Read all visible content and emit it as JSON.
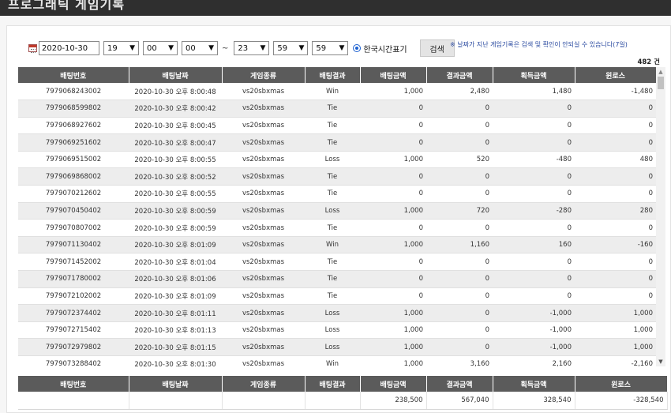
{
  "header": {
    "title": "프로그래틱 게임기록"
  },
  "filter": {
    "date": "2020-10-30",
    "start_hour": "19",
    "start_min": "00",
    "start_sec": "00",
    "separator": "~",
    "end_hour": "23",
    "end_min": "59",
    "end_sec": "59",
    "radio_label": "한국시간표기",
    "search_label": "검색",
    "notice": "※ 날짜가 지난 게임기록은 검색 및 확인이 안되실 수 있습니다(7일)"
  },
  "total_count": "482 건",
  "columns": [
    "배팅번호",
    "배팅날짜",
    "게임종류",
    "배팅결과",
    "배팅금액",
    "결과금액",
    "획득금액",
    "윈로스"
  ],
  "rows": [
    [
      "7979068243002",
      "2020-10-30 오후 8:00:48",
      "vs20sbxmas",
      "Win",
      "1,000",
      "2,480",
      "1,480",
      "-1,480"
    ],
    [
      "7979068599802",
      "2020-10-30 오후 8:00:42",
      "vs20sbxmas",
      "Tie",
      "0",
      "0",
      "0",
      "0"
    ],
    [
      "7979068927602",
      "2020-10-30 오후 8:00:45",
      "vs20sbxmas",
      "Tie",
      "0",
      "0",
      "0",
      "0"
    ],
    [
      "7979069251602",
      "2020-10-30 오후 8:00:47",
      "vs20sbxmas",
      "Tie",
      "0",
      "0",
      "0",
      "0"
    ],
    [
      "7979069515002",
      "2020-10-30 오후 8:00:55",
      "vs20sbxmas",
      "Loss",
      "1,000",
      "520",
      "-480",
      "480"
    ],
    [
      "7979069868002",
      "2020-10-30 오후 8:00:52",
      "vs20sbxmas",
      "Tie",
      "0",
      "0",
      "0",
      "0"
    ],
    [
      "7979070212602",
      "2020-10-30 오후 8:00:55",
      "vs20sbxmas",
      "Tie",
      "0",
      "0",
      "0",
      "0"
    ],
    [
      "7979070450402",
      "2020-10-30 오후 8:00:59",
      "vs20sbxmas",
      "Loss",
      "1,000",
      "720",
      "-280",
      "280"
    ],
    [
      "7979070807002",
      "2020-10-30 오후 8:00:59",
      "vs20sbxmas",
      "Tie",
      "0",
      "0",
      "0",
      "0"
    ],
    [
      "7979071130402",
      "2020-10-30 오후 8:01:09",
      "vs20sbxmas",
      "Win",
      "1,000",
      "1,160",
      "160",
      "-160"
    ],
    [
      "7979071452002",
      "2020-10-30 오후 8:01:04",
      "vs20sbxmas",
      "Tie",
      "0",
      "0",
      "0",
      "0"
    ],
    [
      "7979071780002",
      "2020-10-30 오후 8:01:06",
      "vs20sbxmas",
      "Tie",
      "0",
      "0",
      "0",
      "0"
    ],
    [
      "7979072102002",
      "2020-10-30 오후 8:01:09",
      "vs20sbxmas",
      "Tie",
      "0",
      "0",
      "0",
      "0"
    ],
    [
      "7979072374402",
      "2020-10-30 오후 8:01:11",
      "vs20sbxmas",
      "Loss",
      "1,000",
      "0",
      "-1,000",
      "1,000"
    ],
    [
      "7979072715402",
      "2020-10-30 오후 8:01:13",
      "vs20sbxmas",
      "Loss",
      "1,000",
      "0",
      "-1,000",
      "1,000"
    ],
    [
      "7979072979802",
      "2020-10-30 오후 8:01:15",
      "vs20sbxmas",
      "Loss",
      "1,000",
      "0",
      "-1,000",
      "1,000"
    ],
    [
      "7979073288402",
      "2020-10-30 오후 8:01:30",
      "vs20sbxmas",
      "Win",
      "1,000",
      "3,160",
      "2,160",
      "-2,160"
    ]
  ],
  "totals": [
    "",
    "",
    "",
    "",
    "238,500",
    "567,040",
    "328,540",
    "-328,540"
  ],
  "colors": {
    "header_bg": "#5b5b5b",
    "alt_row": "#ededed",
    "notice": "#2a4aa0",
    "radio": "#1a5fd0"
  },
  "icons": {
    "date_picker": "calendar-icon",
    "select": "chevron-down-icon",
    "scroll_up": "arrow-up-icon",
    "scroll_down": "arrow-down-icon"
  }
}
